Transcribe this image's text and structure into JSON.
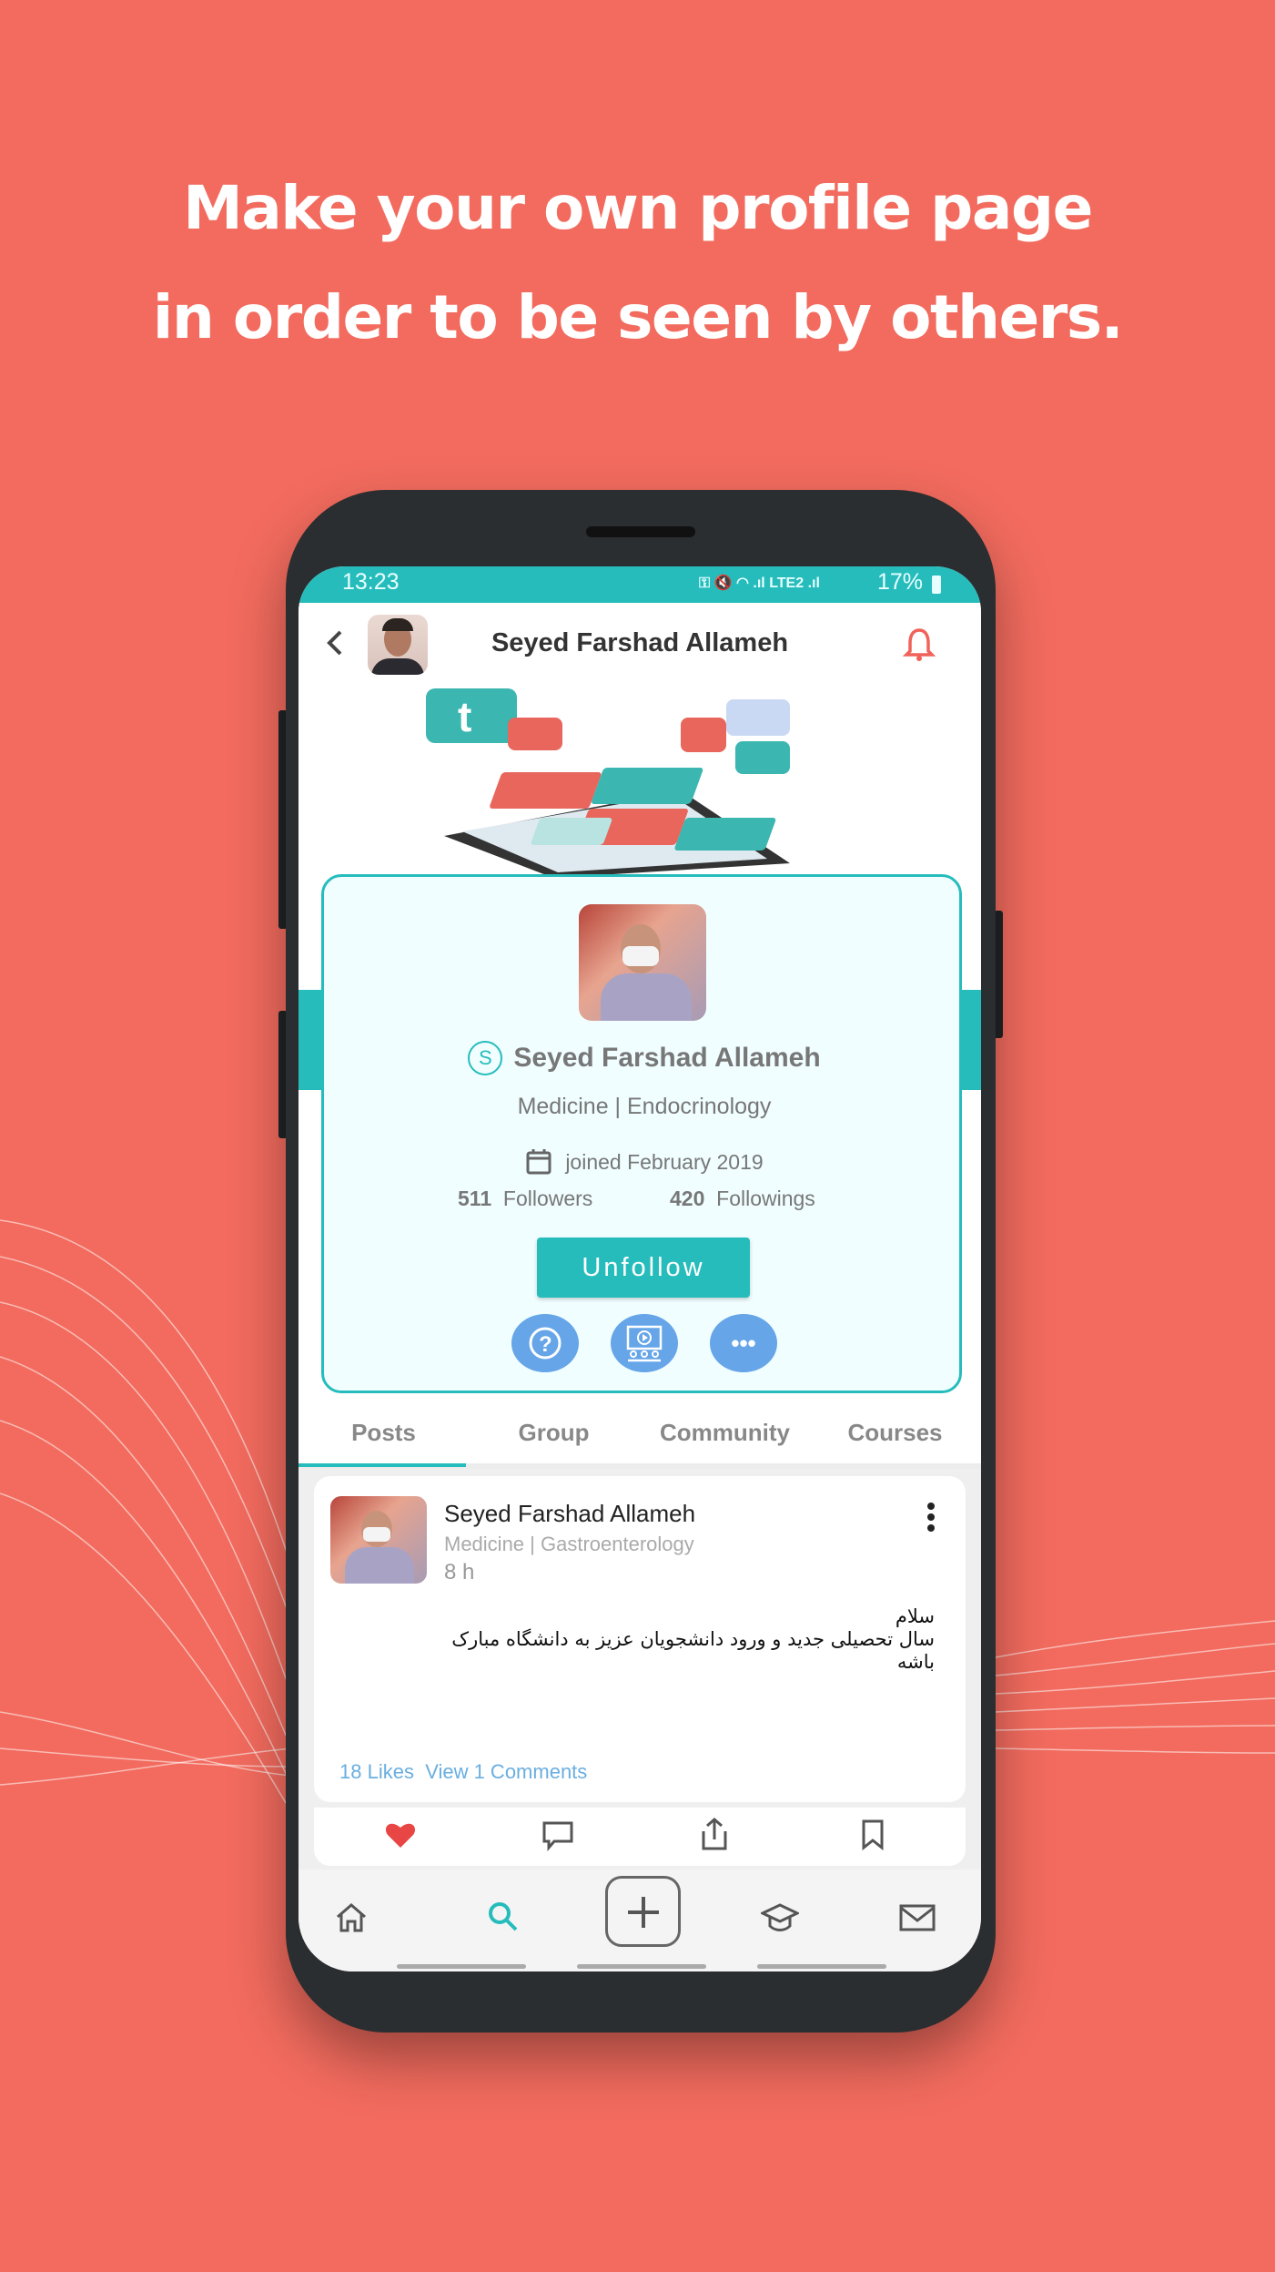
{
  "headline": {
    "line1": "Make your own profile page",
    "line2": "in order to be seen by others."
  },
  "status_bar": {
    "time": "13:23",
    "battery": "17%",
    "network": "LTE2"
  },
  "header": {
    "title": "Seyed Farshad Allameh",
    "back_icon": "chevron-left-icon",
    "bell_icon": "bell-icon"
  },
  "profile": {
    "badge": "S",
    "name": "Seyed Farshad Allameh",
    "specialty": "Medicine | Endocrinology",
    "joined": "joined February 2019",
    "followers_count": "511",
    "followers_label": "Followers",
    "followings_count": "420",
    "followings_label": "Followings",
    "unfollow_label": "Unfollow"
  },
  "tabs": [
    {
      "label": "Posts",
      "active": true
    },
    {
      "label": "Group"
    },
    {
      "label": "Community"
    },
    {
      "label": "Courses"
    }
  ],
  "post": {
    "author": "Seyed Farshad Allameh",
    "specialty": "Medicine | Gastroenterology",
    "time": "8 h",
    "text_line1": "سلام",
    "text_line2": "سال تحصیلی جدید و ورود دانشجویان عزیز به دانشگاه مبارک",
    "text_line3": "باشه",
    "likes": "18 Likes",
    "comments": "View 1 Comments"
  },
  "colors": {
    "background": "#f26b5e",
    "accent": "#27bcbc",
    "action_blue": "#65a5e8",
    "like_red": "#e84545"
  }
}
